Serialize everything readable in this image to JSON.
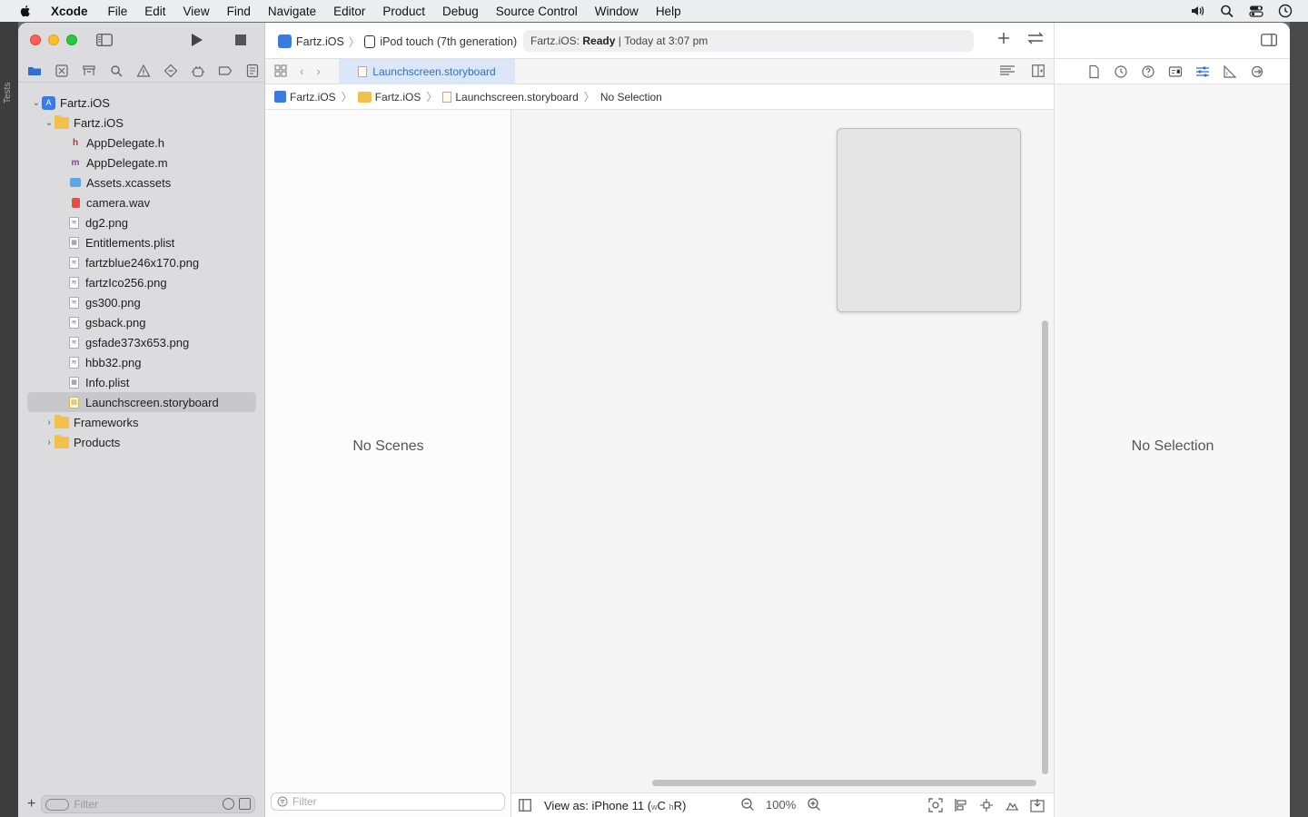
{
  "menubar": {
    "app_name": "Xcode",
    "items": [
      "File",
      "Edit",
      "View",
      "Find",
      "Navigate",
      "Editor",
      "Product",
      "Debug",
      "Source Control",
      "Window",
      "Help"
    ]
  },
  "left_strip": {
    "label": "Tests"
  },
  "toolbar": {
    "scheme_project": "Fartz.iOS",
    "scheme_device": "iPod touch (7th generation)",
    "status_project": "Fartz.iOS:",
    "status_state": "Ready",
    "status_time": "Today at 3:07 pm"
  },
  "navigator": {
    "tree": [
      {
        "label": "Fartz.iOS",
        "kind": "project",
        "level": 0,
        "expanded": true
      },
      {
        "label": "Fartz.iOS",
        "kind": "folder",
        "level": 1,
        "expanded": true
      },
      {
        "label": "AppDelegate.h",
        "kind": "h",
        "level": 2
      },
      {
        "label": "AppDelegate.m",
        "kind": "m",
        "level": 2
      },
      {
        "label": "Assets.xcassets",
        "kind": "assets",
        "level": 2
      },
      {
        "label": "camera.wav",
        "kind": "audio",
        "level": 2
      },
      {
        "label": "dg2.png",
        "kind": "image",
        "level": 2
      },
      {
        "label": "Entitlements.plist",
        "kind": "plist",
        "level": 2
      },
      {
        "label": "fartzblue246x170.png",
        "kind": "image",
        "level": 2
      },
      {
        "label": "fartzIco256.png",
        "kind": "image",
        "level": 2
      },
      {
        "label": "gs300.png",
        "kind": "image",
        "level": 2
      },
      {
        "label": "gsback.png",
        "kind": "image",
        "level": 2
      },
      {
        "label": "gsfade373x653.png",
        "kind": "image",
        "level": 2
      },
      {
        "label": "hbb32.png",
        "kind": "image",
        "level": 2
      },
      {
        "label": "Info.plist",
        "kind": "plist",
        "level": 2
      },
      {
        "label": "Launchscreen.storyboard",
        "kind": "storyboard",
        "level": 2,
        "selected": true
      },
      {
        "label": "Frameworks",
        "kind": "folder",
        "level": 1,
        "expanded": false
      },
      {
        "label": "Products",
        "kind": "folder",
        "level": 1,
        "expanded": false
      }
    ],
    "filter_placeholder": "Filter"
  },
  "editor": {
    "tab_label": "Launchscreen.storyboard",
    "jumpbar": [
      "Fartz.iOS",
      "Fartz.iOS",
      "Launchscreen.storyboard",
      "No Selection"
    ],
    "outline_empty": "No Scenes",
    "outline_filter_placeholder": "Filter",
    "view_as_prefix": "View as: iPhone 11 (",
    "view_as_w": "w",
    "view_as_c": "C",
    "view_as_h": "h",
    "view_as_r": "R)",
    "zoom": "100%"
  },
  "inspector": {
    "empty": "No Selection"
  },
  "colors": {
    "accent": "#2f6fd1",
    "selection": "#c8c8cc"
  }
}
